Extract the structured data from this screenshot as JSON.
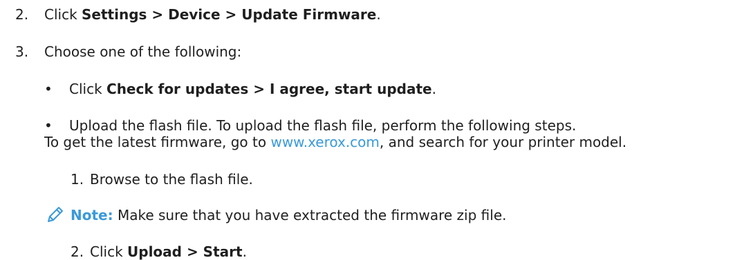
{
  "steps": {
    "step2": {
      "number": "2.",
      "prefix": "Click ",
      "path": "Settings > Device > Update Firmware",
      "suffix": "."
    },
    "step3": {
      "number": "3.",
      "text": "Choose one of the following:"
    }
  },
  "options": {
    "option1": {
      "bullet": "•",
      "prefix": "Click ",
      "path": "Check for updates > I agree, start update",
      "suffix": "."
    },
    "option2": {
      "bullet": "•",
      "text": "Upload the flash file. To upload the flash file, perform the following steps."
    }
  },
  "info": {
    "prefix": "To get the latest firmware, go to ",
    "link_text": "www.xerox.com",
    "suffix": ", and search for your printer model."
  },
  "substeps": {
    "sub1": {
      "number": "1.",
      "text": "Browse to the flash file."
    },
    "sub2": {
      "number": "2.",
      "prefix": "Click ",
      "path": "Upload > Start",
      "suffix": "."
    }
  },
  "note": {
    "icon": "pencil-icon",
    "label": "Note:",
    "text": " Make sure that you have extracted the firmware zip file."
  },
  "colors": {
    "text": "#1f1f1f",
    "accent": "#3a9ad9"
  }
}
